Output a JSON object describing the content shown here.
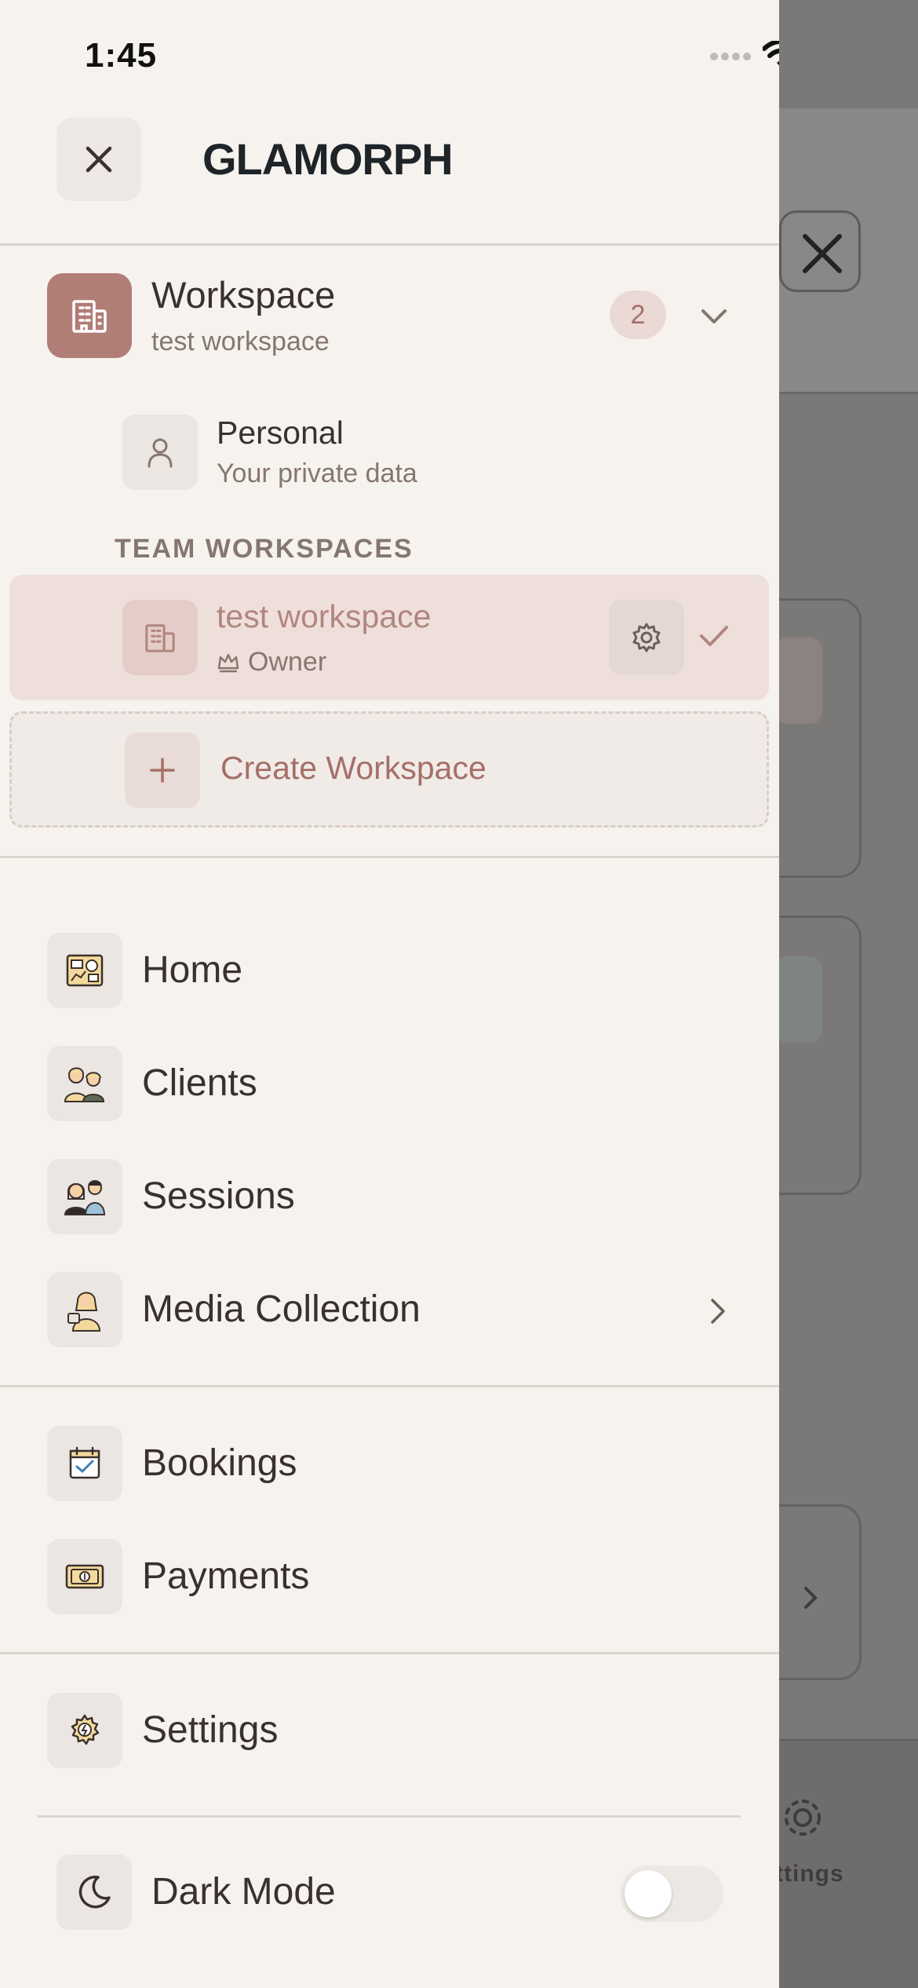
{
  "status": {
    "time": "1:45"
  },
  "header": {
    "brand": "GLAMORPH"
  },
  "workspace": {
    "title": "Workspace",
    "current": "test workspace",
    "count": "2"
  },
  "personal": {
    "title": "Personal",
    "subtitle": "Your private data"
  },
  "team_section": {
    "label": "TEAM WORKSPACES"
  },
  "team_workspaces": [
    {
      "name": "test workspace",
      "role": "Owner",
      "selected": true
    }
  ],
  "create_workspace": {
    "label": "Create Workspace"
  },
  "nav": {
    "home": "Home",
    "clients": "Clients",
    "sessions": "Sessions",
    "media": "Media Collection",
    "bookings": "Bookings",
    "payments": "Payments",
    "settings": "Settings"
  },
  "dark_mode": {
    "label": "Dark Mode",
    "enabled": false
  },
  "background": {
    "tab_settings": "ttings"
  },
  "colors": {
    "accent": "#b17d77",
    "drawer_bg": "#f6f3ef",
    "selected_row": "#efdfdb"
  }
}
